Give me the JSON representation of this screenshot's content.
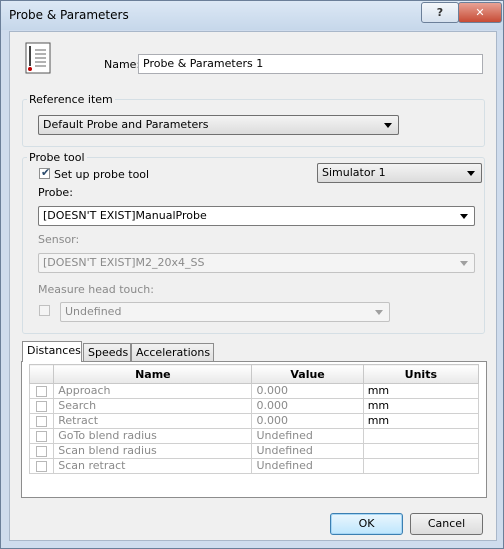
{
  "window": {
    "title": "Probe & Parameters",
    "help_label": "?",
    "close_label": "✕"
  },
  "icon": "probe-parameters-icon",
  "name": {
    "label": "Name:",
    "value": "Probe & Parameters 1"
  },
  "reference": {
    "group_title": "Reference item",
    "selected": "Default Probe and Parameters"
  },
  "probe_tool": {
    "group_title": "Probe tool",
    "setup_label": "Set up probe tool",
    "setup_checked": true,
    "simulator_selected": "Simulator 1",
    "probe_label": "Probe:",
    "probe_selected": "[DOESN'T EXIST]ManualProbe",
    "sensor_label": "Sensor:",
    "sensor_selected": "[DOESN'T EXIST]M2_20x4_SS",
    "head_touch_label": "Measure head touch:",
    "head_touch_selected": "Undefined"
  },
  "tabs": [
    {
      "label": "Distances",
      "active": true
    },
    {
      "label": "Speeds",
      "active": false
    },
    {
      "label": "Accelerations",
      "active": false
    }
  ],
  "table": {
    "headers": [
      "",
      "Name",
      "Value",
      "Units"
    ],
    "rows": [
      {
        "name": "Approach",
        "value": "0.000",
        "units": "mm"
      },
      {
        "name": "Search",
        "value": "0.000",
        "units": "mm"
      },
      {
        "name": "Retract",
        "value": "0.000",
        "units": "mm"
      },
      {
        "name": "GoTo blend radius",
        "value": "Undefined",
        "units": ""
      },
      {
        "name": "Scan blend radius",
        "value": "Undefined",
        "units": ""
      },
      {
        "name": "Scan retract",
        "value": "Undefined",
        "units": ""
      }
    ]
  },
  "buttons": {
    "ok": "OK",
    "cancel": "Cancel"
  }
}
